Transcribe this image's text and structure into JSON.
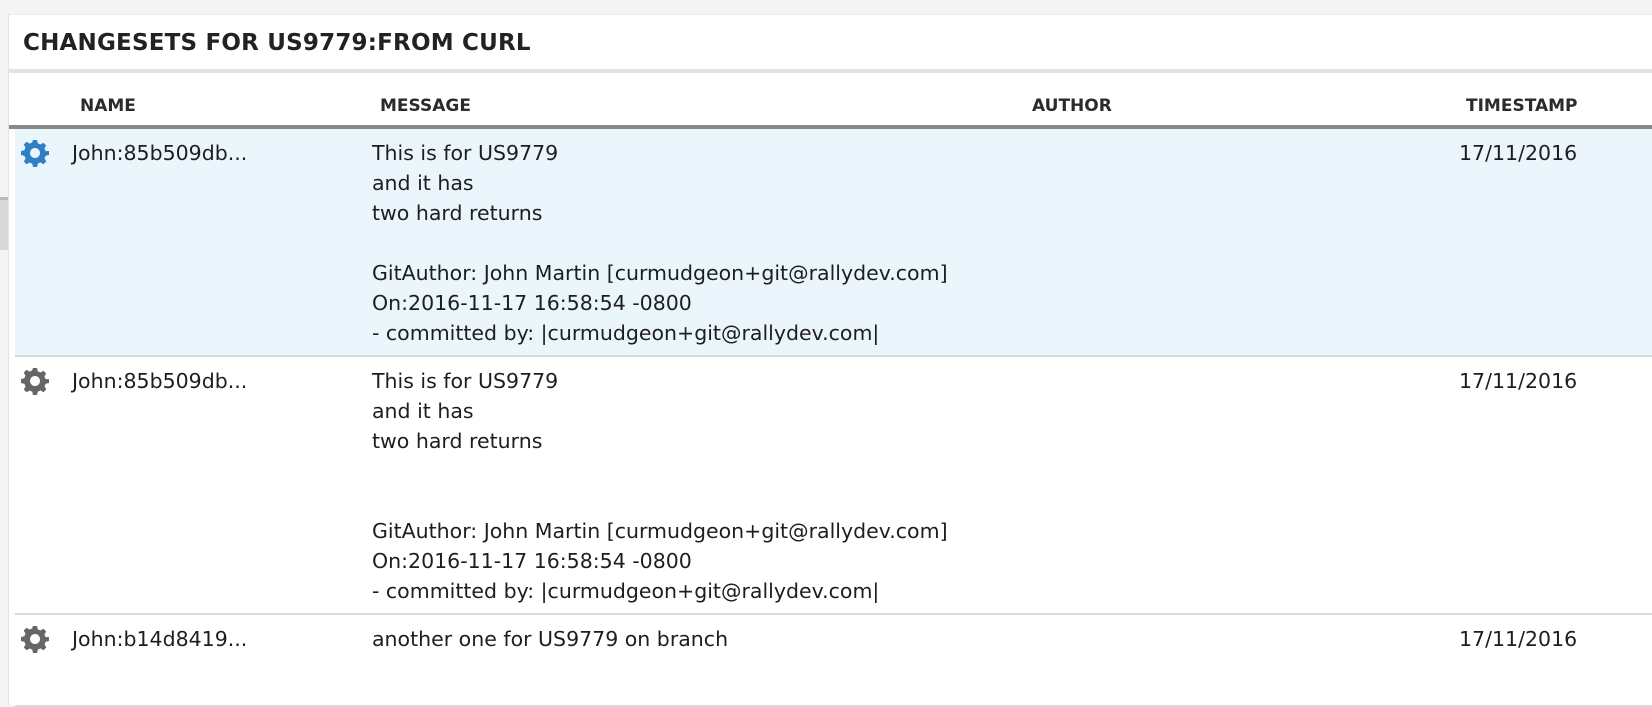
{
  "panel": {
    "title": "CHANGESETS FOR US9779:FROM CURL"
  },
  "grid": {
    "columns": {
      "name": "NAME",
      "message": "MESSAGE",
      "author": "AUTHOR",
      "timestamp": "TIMESTAMP"
    },
    "rows": [
      {
        "icon": "gear-icon",
        "icon_color": "#2f7fc5",
        "selected": true,
        "name": "John:85b509db...",
        "message": "This is for US9779\nand it has\ntwo hard returns\n\nGitAuthor: John Martin [curmudgeon+git@rallydev.com]\nOn:2016-11-17 16:58:54 -0800\n- committed by: |curmudgeon+git@rallydev.com|",
        "author": "",
        "timestamp": "17/11/2016"
      },
      {
        "icon": "gear-icon",
        "icon_color": "#666666",
        "selected": false,
        "name": "John:85b509db...",
        "message": "This is for US9779\nand it has\ntwo hard returns\n\n\nGitAuthor: John Martin [curmudgeon+git@rallydev.com]\nOn:2016-11-17 16:58:54 -0800\n- committed by: |curmudgeon+git@rallydev.com|",
        "author": "",
        "timestamp": "17/11/2016"
      },
      {
        "icon": "gear-icon",
        "icon_color": "#666666",
        "selected": false,
        "name": "John:b14d8419...",
        "message": "another one for US9779 on branch",
        "author": "",
        "timestamp": "17/11/2016"
      }
    ]
  },
  "colors": {
    "selected_row_bg": "#eaf6fb",
    "accent": "#2f7fc5"
  }
}
